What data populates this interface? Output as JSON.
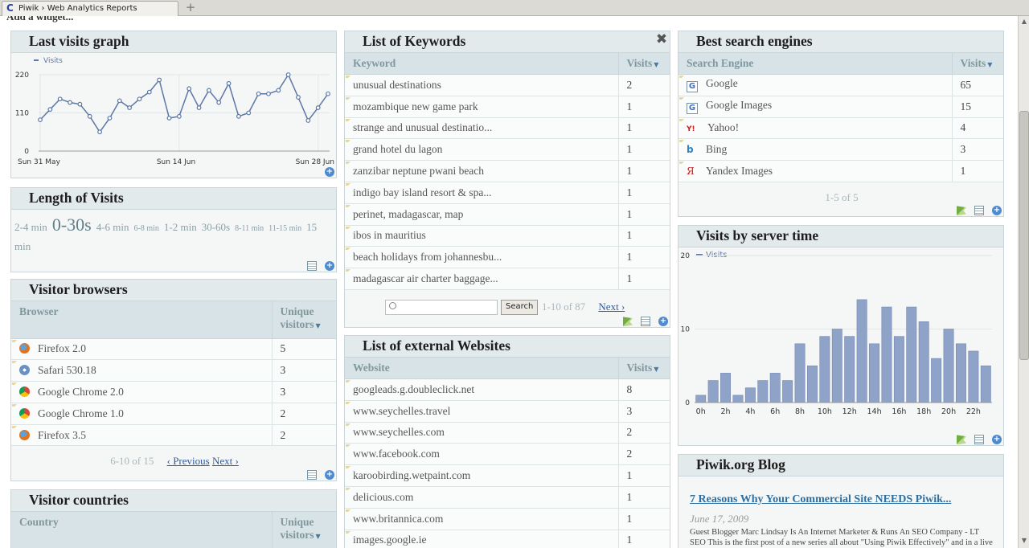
{
  "browser": {
    "tab_title": "Piwik › Web Analytics Reports",
    "new_tab_glyph": "+"
  },
  "page": {
    "add_widget_label": "Add a widget..."
  },
  "last_visits_graph": {
    "title": "Last visits graph",
    "chart_data": {
      "type": "line",
      "series": [
        {
          "name": "Visits",
          "values": [
            90,
            120,
            150,
            140,
            135,
            100,
            55,
            95,
            145,
            125,
            150,
            170,
            205,
            95,
            100,
            180,
            125,
            175,
            140,
            195,
            100,
            110,
            165,
            165,
            175,
            220,
            155,
            88,
            125,
            165
          ]
        }
      ],
      "x_tick_labels": [
        "Sun 31 May",
        "Sun 14 Jun",
        "Sun 28 Jun"
      ],
      "y_tick_labels": [
        "220",
        "110",
        "0"
      ],
      "ylim": [
        0,
        220
      ],
      "grid": true,
      "legend": "top-left",
      "line_color": "#5b77a6"
    }
  },
  "length_of_visits": {
    "title": "Length of Visits",
    "tags": [
      {
        "label": "2-4 min",
        "size": 13
      },
      {
        "label": "0-30s",
        "size": 22
      },
      {
        "label": "4-6 min",
        "size": 13
      },
      {
        "label": "6-8 min",
        "size": 10
      },
      {
        "label": "1-2 min",
        "size": 13
      },
      {
        "label": "30-60s",
        "size": 13
      },
      {
        "label": "8-11 min",
        "size": 10
      },
      {
        "label": "11-15 min",
        "size": 10
      },
      {
        "label": "15 min",
        "size": 13
      }
    ]
  },
  "visitor_browsers": {
    "title": "Visitor browsers",
    "col_browser": "Browser",
    "col_unique": "Unique visitors",
    "rows": [
      {
        "icon": "firefox-icon",
        "label": "Firefox 2.0",
        "value": "5"
      },
      {
        "icon": "safari-icon",
        "label": "Safari 530.18",
        "value": "3"
      },
      {
        "icon": "chrome-icon",
        "label": "Google Chrome 2.0",
        "value": "3"
      },
      {
        "icon": "chrome-icon",
        "label": "Google Chrome 1.0",
        "value": "2"
      },
      {
        "icon": "firefox-icon",
        "label": "Firefox 3.5",
        "value": "2"
      }
    ],
    "pager_range": "6-10 of 15",
    "prev_label": "‹ Previous",
    "next_label": "Next ›"
  },
  "visitor_countries": {
    "title": "Visitor countries",
    "col_country": "Country",
    "col_unique": "Unique visitors"
  },
  "list_of_keywords": {
    "title": "List of Keywords",
    "col_keyword": "Keyword",
    "col_visits": "Visits",
    "rows": [
      {
        "label": "unusual destinations",
        "value": "2"
      },
      {
        "label": "mozambique new game park",
        "value": "1"
      },
      {
        "label": "strange and unusual destinatio...",
        "value": "1"
      },
      {
        "label": "grand hotel du lagon",
        "value": "1"
      },
      {
        "label": "zanzibar neptune pwani beach",
        "value": "1"
      },
      {
        "label": "indigo bay island resort & spa...",
        "value": "1"
      },
      {
        "label": "perinet, madagascar, map",
        "value": "1"
      },
      {
        "label": "ibos in mauritius",
        "value": "1"
      },
      {
        "label": "beach holidays from johannesbu...",
        "value": "1"
      },
      {
        "label": "madagascar air charter baggage...",
        "value": "1"
      }
    ],
    "search_button": "Search",
    "pager_range": "1-10 of 87",
    "next_label": "Next ›"
  },
  "list_of_external_websites": {
    "title": "List of external Websites",
    "col_website": "Website",
    "col_visits": "Visits",
    "rows": [
      {
        "label": "googleads.g.doubleclick.net",
        "value": "8"
      },
      {
        "label": "www.seychelles.travel",
        "value": "3"
      },
      {
        "label": "www.seychelles.com",
        "value": "2"
      },
      {
        "label": "www.facebook.com",
        "value": "2"
      },
      {
        "label": "karoobirding.wetpaint.com",
        "value": "1"
      },
      {
        "label": "delicious.com",
        "value": "1"
      },
      {
        "label": "www.britannica.com",
        "value": "1"
      },
      {
        "label": "images.google.ie",
        "value": "1"
      }
    ]
  },
  "best_search_engines": {
    "title": "Best search engines",
    "col_engine": "Search Engine",
    "col_visits": "Visits",
    "rows": [
      {
        "icon": "google-icon",
        "glyph": "G",
        "label": "Google",
        "value": "65"
      },
      {
        "icon": "google-icon",
        "glyph": "G",
        "label": "Google Images",
        "value": "15"
      },
      {
        "icon": "yahoo-icon",
        "glyph": "Y!",
        "label": "Yahoo!",
        "value": "4"
      },
      {
        "icon": "bing-icon",
        "glyph": "b",
        "label": "Bing",
        "value": "3"
      },
      {
        "icon": "yandex-icon",
        "glyph": "Я",
        "label": "Yandex Images",
        "value": "1"
      }
    ],
    "pager_range": "1-5 of 5"
  },
  "visits_by_server_time": {
    "title": "Visits by server time",
    "chart_data": {
      "type": "bar",
      "categories": [
        "0h",
        "1h",
        "2h",
        "3h",
        "4h",
        "5h",
        "6h",
        "7h",
        "8h",
        "9h",
        "10h",
        "11h",
        "12h",
        "13h",
        "14h",
        "15h",
        "16h",
        "17h",
        "18h",
        "19h",
        "20h",
        "21h",
        "22h",
        "23h"
      ],
      "x_tick_labels": [
        "0h",
        "2h",
        "4h",
        "6h",
        "8h",
        "10h",
        "12h",
        "14h",
        "16h",
        "18h",
        "20h",
        "22h"
      ],
      "series": [
        {
          "name": "Visits",
          "values": [
            1,
            3,
            4,
            1,
            2,
            3,
            4,
            3,
            8,
            5,
            9,
            10,
            9,
            14,
            8,
            13,
            9,
            13,
            11,
            6,
            10,
            8,
            7,
            5
          ]
        }
      ],
      "y_tick_labels": [
        "20",
        "10",
        "0"
      ],
      "ylim": [
        0,
        20
      ],
      "grid": true,
      "legend": "top-left",
      "bar_color": "#8fa3c9"
    }
  },
  "piwik_blog": {
    "title": "Piwik.org Blog",
    "post_title": "7 Reasons Why Your Commercial Site NEEDS Piwik...",
    "post_date": "June 17, 2009",
    "post_excerpt": "Guest Blogger Marc Lindsay Is An Internet Marketer & Runs An SEO Company - LT SEO This is the first post of a new series all about \"Using Piwik Effectively\" and in a live environment. Designed to help both businessman & hobbyist make the most out"
  }
}
